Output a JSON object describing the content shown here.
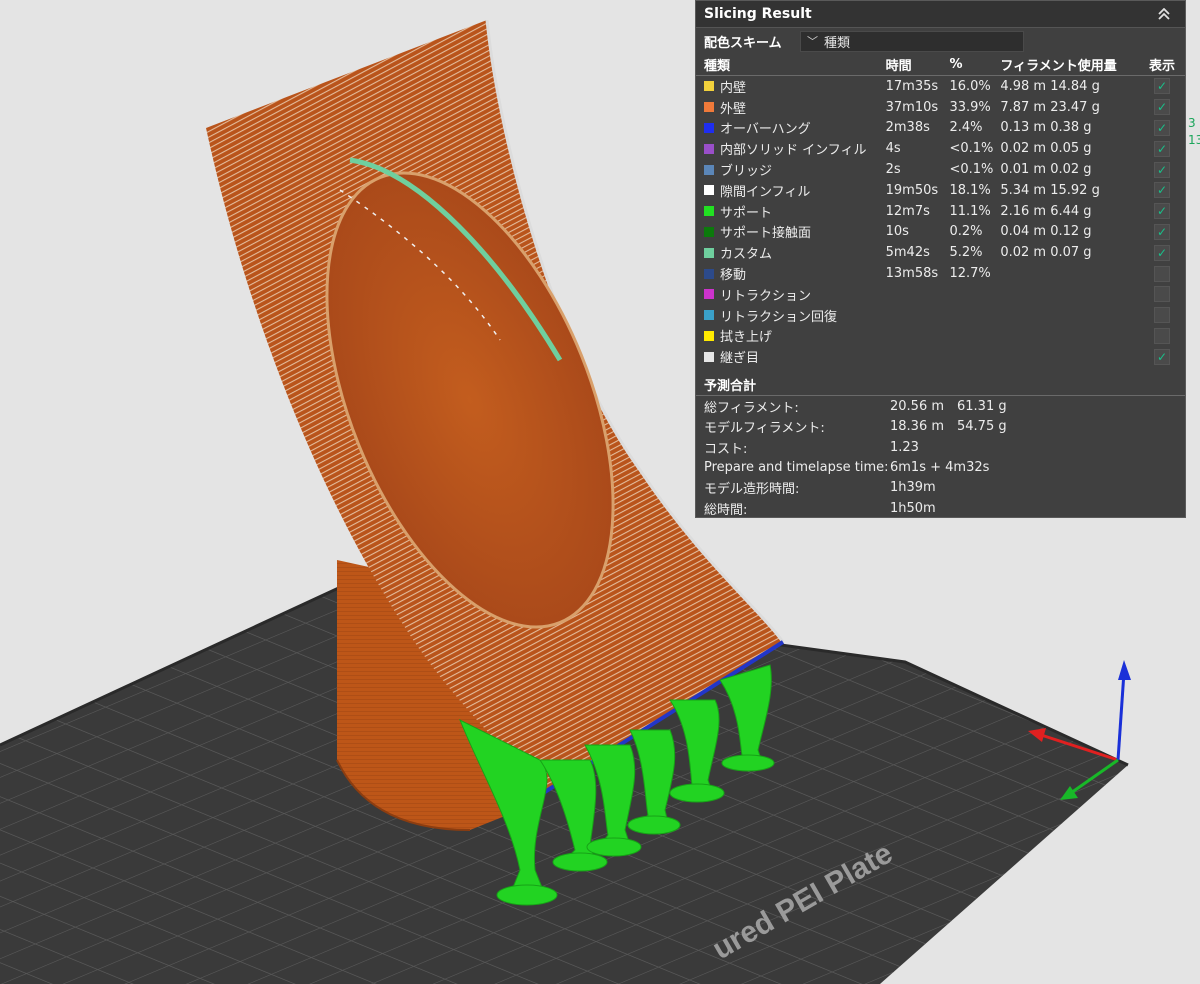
{
  "panel": {
    "title": "Slicing Result",
    "scheme_label": "配色スキーム",
    "scheme_value": "種類",
    "headers": {
      "type": "種類",
      "time": "時間",
      "percent": "%",
      "filament": "フィラメント使用量",
      "show": "表示"
    },
    "rows": [
      {
        "label": "内壁",
        "color": "#f2d13c",
        "time": "17m35s",
        "percent": "16.0%",
        "filament": "4.98 m  14.84 g",
        "checked": true
      },
      {
        "label": "外壁",
        "color": "#f07a3a",
        "time": "37m10s",
        "percent": "33.9%",
        "filament": "7.87 m  23.47 g",
        "checked": true
      },
      {
        "label": "オーバーハング",
        "color": "#1f2ef0",
        "time": "2m38s",
        "percent": "2.4%",
        "filament": "0.13 m  0.38 g",
        "checked": true
      },
      {
        "label": "内部ソリッド インフィル",
        "color": "#9a4fc9",
        "time": "4s",
        "percent": "<0.1%",
        "filament": "0.02 m  0.05 g",
        "checked": true
      },
      {
        "label": "ブリッジ",
        "color": "#5b86b8",
        "time": "2s",
        "percent": "<0.1%",
        "filament": "0.01 m  0.02 g",
        "checked": true
      },
      {
        "label": "隙間インフィル",
        "color": "#ffffff",
        "time": "19m50s",
        "percent": "18.1%",
        "filament": "5.34 m  15.92 g",
        "checked": true
      },
      {
        "label": "サポート",
        "color": "#22e022",
        "time": "12m7s",
        "percent": "11.1%",
        "filament": "2.16 m  6.44 g",
        "checked": true
      },
      {
        "label": "サポート接触面",
        "color": "#0c7a0c",
        "time": "10s",
        "percent": "0.2%",
        "filament": "0.04 m  0.12 g",
        "checked": true
      },
      {
        "label": "カスタム",
        "color": "#6fcf9e",
        "time": "5m42s",
        "percent": "5.2%",
        "filament": "0.02 m  0.07 g",
        "checked": true
      },
      {
        "label": "移動",
        "color": "#2c4a8a",
        "time": "13m58s",
        "percent": "12.7%",
        "filament": "",
        "checked": false
      },
      {
        "label": "リトラクション",
        "color": "#cc33cc",
        "time": "",
        "percent": "",
        "filament": "",
        "checked": false
      },
      {
        "label": "リトラクション回復",
        "color": "#3aa0c8",
        "time": "",
        "percent": "",
        "filament": "",
        "checked": false
      },
      {
        "label": "拭き上げ",
        "color": "#ffea00",
        "time": "",
        "percent": "",
        "filament": "",
        "checked": false
      },
      {
        "label": "継ぎ目",
        "color": "#e6e6e6",
        "time": "",
        "percent": "",
        "filament": "",
        "checked": true
      }
    ],
    "summary_title": "予測合計",
    "summary": [
      {
        "label": "総フィラメント:",
        "v1": "20.56 m",
        "v2": "61.31 g"
      },
      {
        "label": "モデルフィラメント:",
        "v1": "18.36 m",
        "v2": "54.75 g"
      },
      {
        "label": "コスト:",
        "v1": "1.23",
        "v2": ""
      },
      {
        "label": "Prepare and timelapse time:",
        "v1": "6m1s + 4m32s",
        "v2": ""
      },
      {
        "label": "モデル造形時間:",
        "v1": "1h39m",
        "v2": ""
      },
      {
        "label": "総時間:",
        "v1": "1h50m",
        "v2": ""
      }
    ]
  },
  "side_numbers": [
    "3",
    "13"
  ],
  "plate_label": "ured PEI Plate",
  "colors": {
    "background": "#e4e4e4",
    "plate": "#3b3b3b",
    "model": "#b8531a",
    "support": "#22d322",
    "panel": "#404040"
  }
}
